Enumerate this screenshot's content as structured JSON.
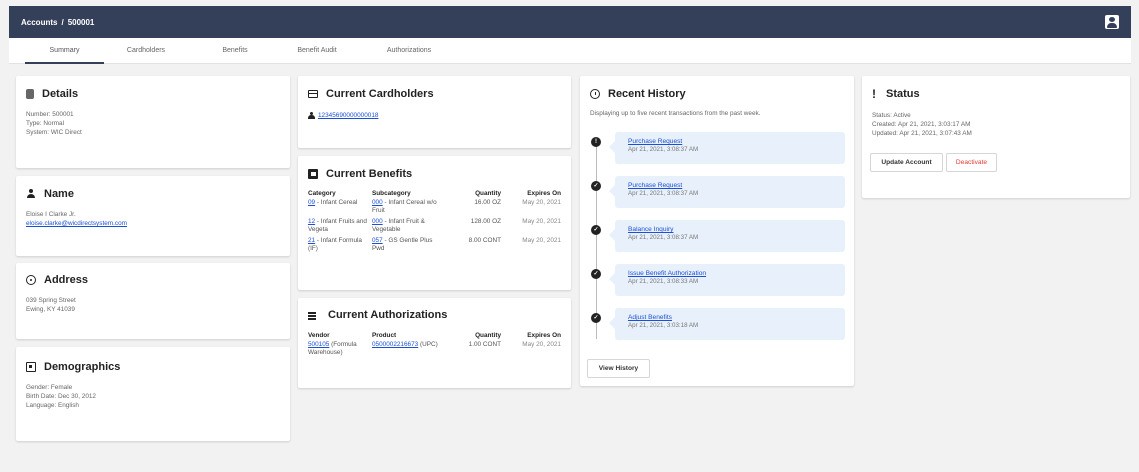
{
  "header": {
    "breadcrumb_root": "Accounts",
    "separator": "/",
    "account_id": "500001"
  },
  "tabs": [
    "Summary",
    "Cardholders",
    "Benefits",
    "Benefit Audit",
    "Authorizations"
  ],
  "details": {
    "title": "Details",
    "lines": [
      "Number: 500001",
      "Type:   Normal",
      "System: WIC Direct"
    ]
  },
  "name": {
    "title": "Name",
    "full_name": "Eloise I Clarke Jr.",
    "email": "eloise.clarke@wicdirectsystem.com"
  },
  "address": {
    "title": "Address",
    "line1": "039 Spring Street",
    "line2": "Ewing, KY 41039"
  },
  "demographics": {
    "title": "Demographics",
    "lines": [
      "Gender:   Female",
      "Birth Date: Dec 30, 2012",
      "Language: English"
    ]
  },
  "cardholders": {
    "title": "Current Cardholders",
    "card_number": "12345690000000018"
  },
  "benefits": {
    "title": "Current Benefits",
    "headers": [
      "Category",
      "Subcategory",
      "Quantity",
      "Expires On"
    ],
    "rows": [
      {
        "cat_code": "09",
        "cat_name": " - Infant Cereal",
        "sub_code": "000",
        "sub_name": " - Infant Cereal w/o Fruit",
        "qty": "16.00 OZ",
        "exp": "May 20, 2021"
      },
      {
        "cat_code": "12",
        "cat_name": " - Infant Fruits and Vegeta",
        "sub_code": "000",
        "sub_name": " - Infant Fruit & Vegetable",
        "qty": "128.00 OZ",
        "exp": "May 20, 2021"
      },
      {
        "cat_code": "21",
        "cat_name": " - Infant Formula (IF)",
        "sub_code": "057",
        "sub_name": " - GS Gentle Plus Pwd",
        "qty": "8.00 CONT",
        "exp": "May 20, 2021"
      }
    ]
  },
  "authorizations": {
    "title": "Current Authorizations",
    "headers": [
      "Vendor",
      "Product",
      "Quantity",
      "Expires On"
    ],
    "rows": [
      {
        "vendor_code": "500105",
        "vendor_name": " (Formula Warehouse)",
        "product_code": "0500002216673",
        "product_name": " (UPC)",
        "qty": "1.00 CONT",
        "exp": "May 20, 2021"
      }
    ]
  },
  "history": {
    "title": "Recent History",
    "subtitle": "Displaying up to five recent transactions from the past week.",
    "items": [
      {
        "title": "Purchase Request",
        "date": "Apr 21, 2021, 3:08:37 AM",
        "status": "!"
      },
      {
        "title": "Purchase Request",
        "date": "Apr 21, 2021, 3:08:37 AM",
        "status": "✓"
      },
      {
        "title": "Balance Inquiry",
        "date": "Apr 21, 2021, 3:08:37 AM",
        "status": "✓"
      },
      {
        "title": "Issue Benefit Authorization",
        "date": "Apr 21, 2021, 3:08:33 AM",
        "status": "✓"
      },
      {
        "title": "Adjust Benefits",
        "date": "Apr 21, 2021, 3:03:18 AM",
        "status": "✓"
      }
    ],
    "view_button": "View History"
  },
  "status": {
    "title": "Status",
    "icon_glyph": "!",
    "lines": [
      "Status:   Active",
      "Created:  Apr 21, 2021, 3:03:17 AM",
      "Updated: Apr 21, 2021, 3:07:43 AM"
    ],
    "update_button": "Update Account",
    "deactivate_button": "Deactivate"
  }
}
